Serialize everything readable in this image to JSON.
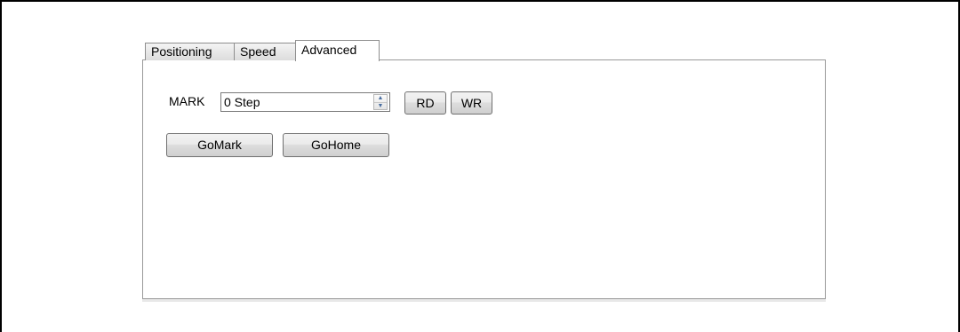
{
  "tabs": [
    {
      "label": "Positioning",
      "active": false
    },
    {
      "label": "Speed",
      "active": false
    },
    {
      "label": "Advanced",
      "active": true
    }
  ],
  "advanced": {
    "mark_label": "MARK",
    "mark_value": "0 Step",
    "rd_label": "RD",
    "wr_label": "WR",
    "gomark_label": "GoMark",
    "gohome_label": "GoHome"
  },
  "icons": {
    "spin_up": "triangle-up",
    "spin_down": "triangle-down"
  }
}
